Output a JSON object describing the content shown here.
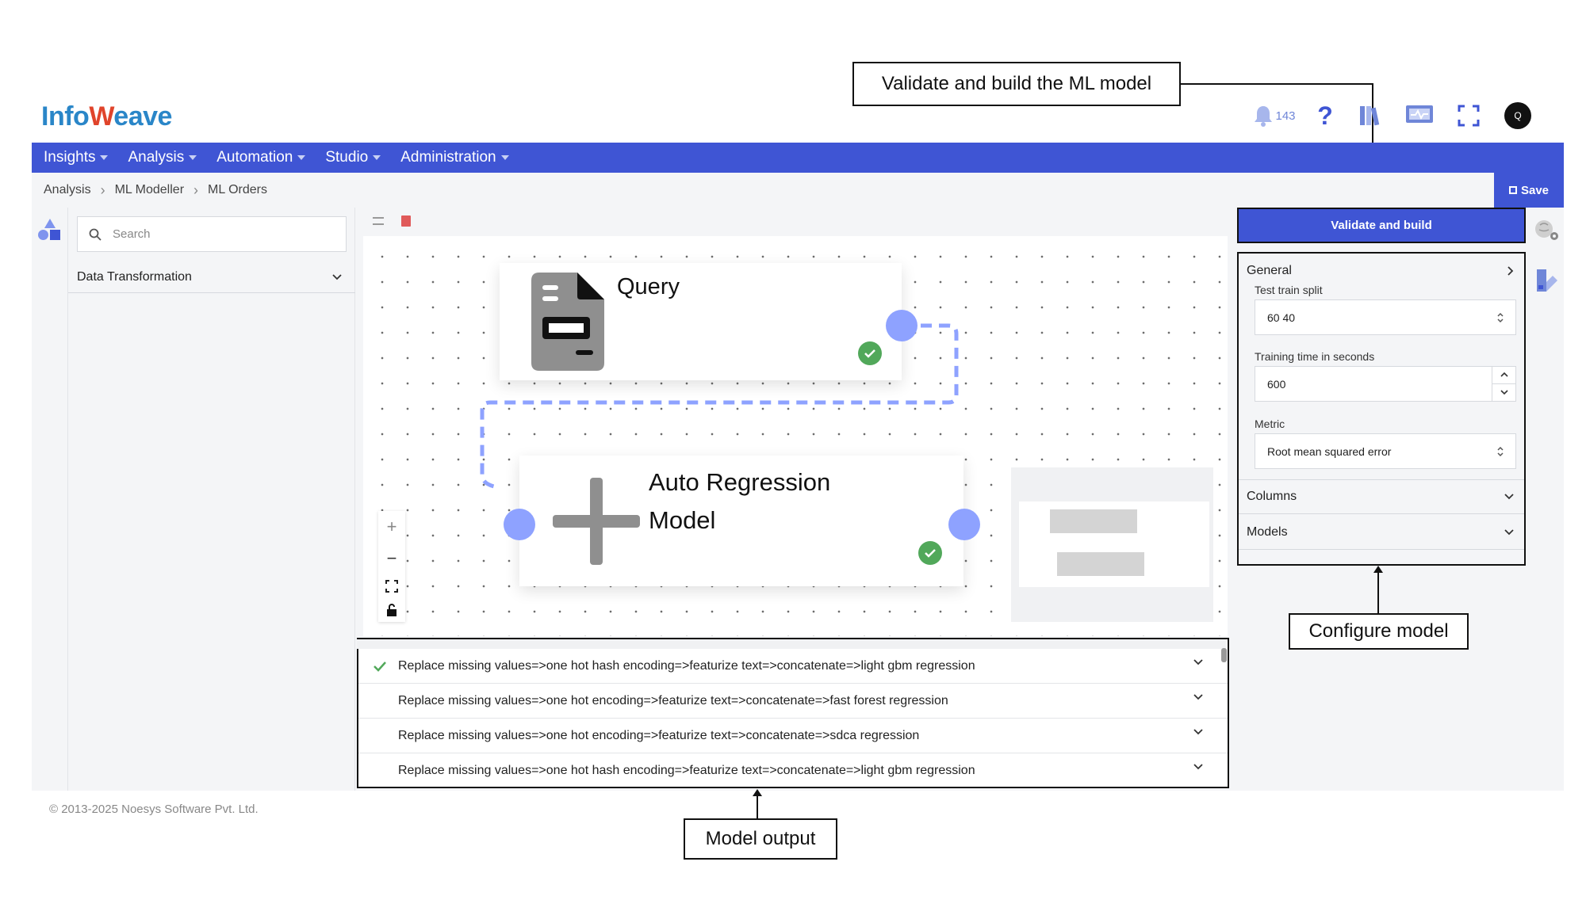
{
  "brand": {
    "part1": "Info",
    "part2": "eave"
  },
  "header": {
    "notification_count": "143"
  },
  "nav": {
    "items": [
      "Insights",
      "Analysis",
      "Automation",
      "Studio",
      "Administration"
    ]
  },
  "breadcrumb": [
    "Analysis",
    "ML Modeller",
    "ML Orders"
  ],
  "toolbar": {
    "save_label": "Save"
  },
  "sidebar": {
    "search_placeholder": "Search",
    "section": "Data Transformation"
  },
  "canvas": {
    "nodes": {
      "query": "Query",
      "auto_regression_line1": "Auto Regression",
      "auto_regression_line2": "Model"
    },
    "zoom": {
      "in": "+",
      "out": "−"
    }
  },
  "output": {
    "rows": [
      "Replace missing values=>one hot hash encoding=>featurize text=>concatenate=>light gbm regression",
      "Replace missing values=>one hot encoding=>featurize text=>concatenate=>fast forest regression",
      "Replace missing values=>one hot encoding=>featurize text=>concatenate=>sdca regression",
      "Replace missing values=>one hot hash encoding=>featurize text=>concatenate=>light gbm regression"
    ]
  },
  "config": {
    "validate_label": "Validate and build",
    "general": "General",
    "test_train_split_label": "Test train split",
    "test_train_split_value": "60 40",
    "training_time_label": "Training time in seconds",
    "training_time_value": "600",
    "metric_label": "Metric",
    "metric_value": "Root mean squared error",
    "columns": "Columns",
    "models": "Models"
  },
  "annotations": {
    "validate": "Validate and build the ML model",
    "configure": "Configure model",
    "output": "Model output"
  },
  "footer": {
    "copyright": "© 2013-2025 Noesys Software Pvt. Ltd."
  },
  "colors": {
    "primary": "#3f55d4",
    "port": "#8ea2ff",
    "check": "#51a85a"
  }
}
